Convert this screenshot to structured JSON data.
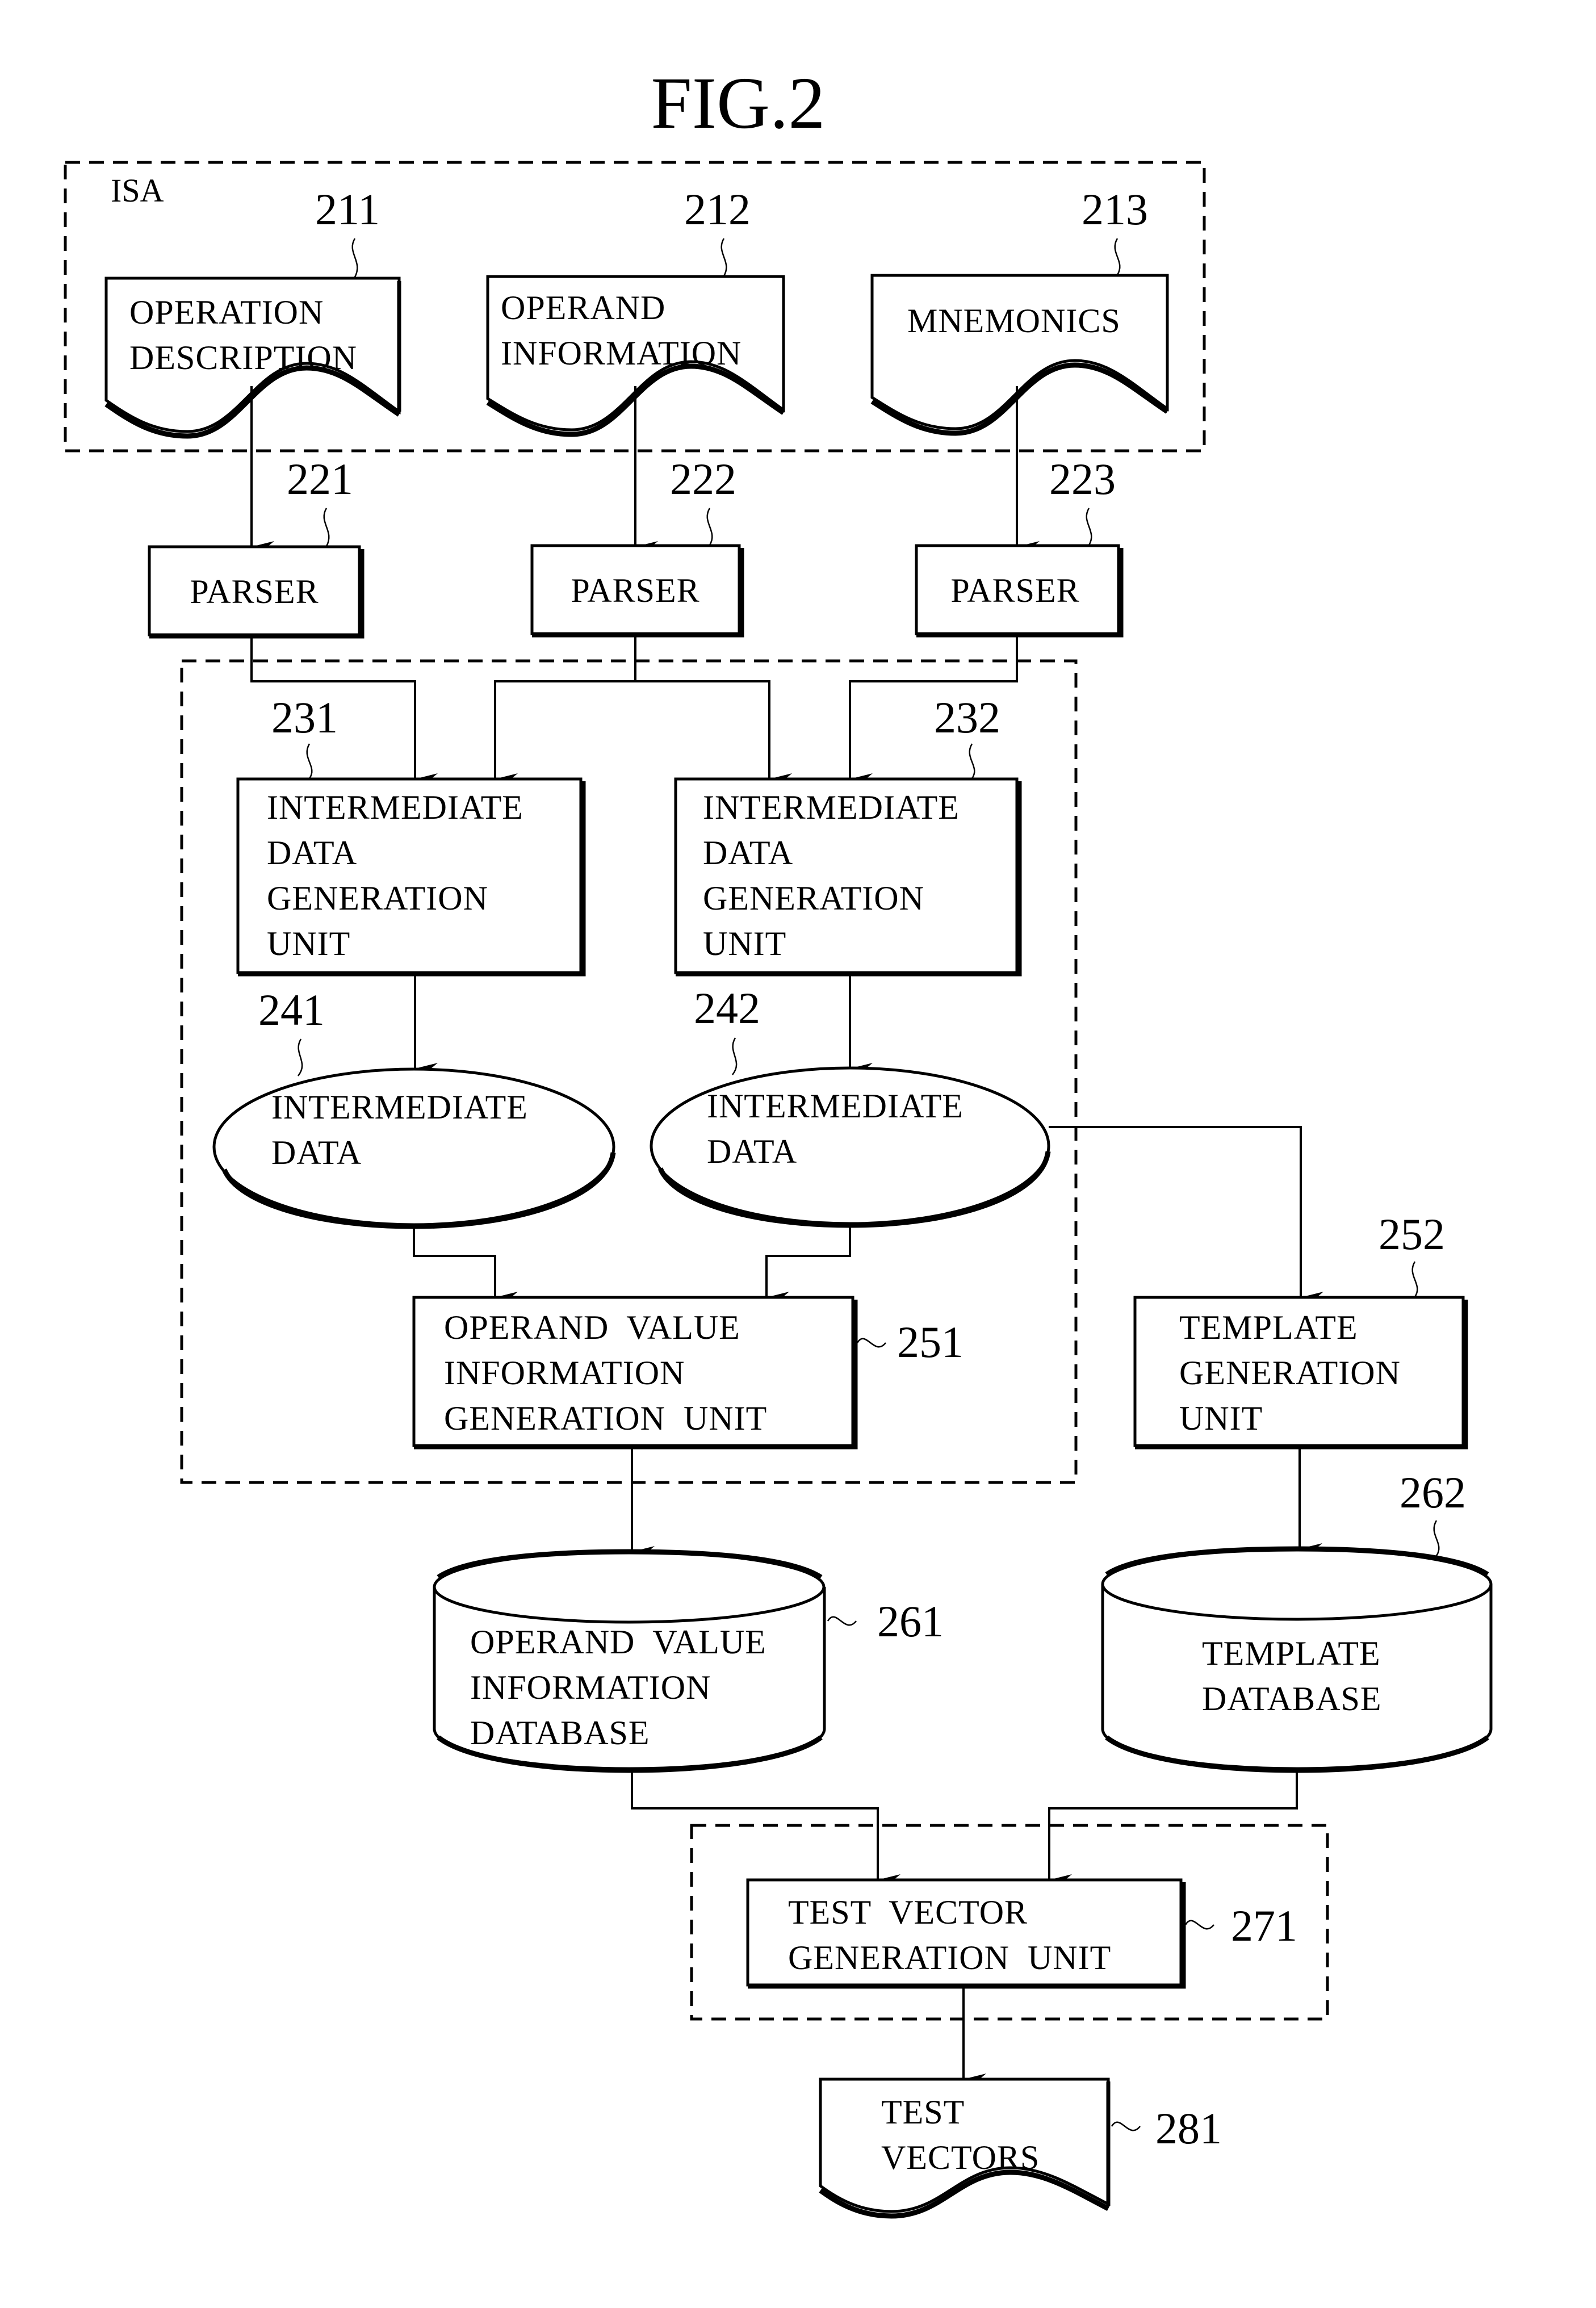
{
  "figure": {
    "title": "FIG.2"
  },
  "isa_group": {
    "label": "ISA"
  },
  "documents": [
    {
      "ref": "211",
      "lines": [
        "OPERATION",
        "DESCRIPTION"
      ]
    },
    {
      "ref": "212",
      "lines": [
        "OPERAND",
        "INFORMATION"
      ]
    },
    {
      "ref": "213",
      "lines": [
        "MNEMONICS"
      ]
    }
  ],
  "parsers": [
    {
      "ref": "221",
      "label": "PARSER"
    },
    {
      "ref": "222",
      "label": "PARSER"
    },
    {
      "ref": "223",
      "label": "PARSER"
    }
  ],
  "intermediate_units": [
    {
      "ref": "231",
      "lines": [
        "INTERMEDIATE",
        "DATA",
        "GENERATION",
        "UNIT"
      ]
    },
    {
      "ref": "232",
      "lines": [
        "INTERMEDIATE",
        "DATA",
        "GENERATION",
        "UNIT"
      ]
    }
  ],
  "intermediate_data": [
    {
      "ref": "241",
      "lines": [
        "INTERMEDIATE",
        "DATA"
      ]
    },
    {
      "ref": "242",
      "lines": [
        "INTERMEDIATE",
        "DATA"
      ]
    }
  ],
  "operand_value_unit": {
    "ref": "251",
    "lines": [
      "OPERAND  VALUE",
      "INFORMATION",
      "GENERATION  UNIT"
    ]
  },
  "template_unit": {
    "ref": "252",
    "lines": [
      "TEMPLATE",
      "GENERATION",
      "UNIT"
    ]
  },
  "operand_value_db": {
    "ref": "261",
    "lines": [
      "OPERAND  VALUE",
      "INFORMATION",
      "DATABASE"
    ]
  },
  "template_db": {
    "ref": "262",
    "lines": [
      "TEMPLATE",
      "DATABASE"
    ]
  },
  "test_vector_unit": {
    "ref": "271",
    "lines": [
      "TEST  VECTOR",
      "GENERATION  UNIT"
    ]
  },
  "test_vectors": {
    "ref": "281",
    "lines": [
      "TEST",
      "VECTORS"
    ]
  }
}
